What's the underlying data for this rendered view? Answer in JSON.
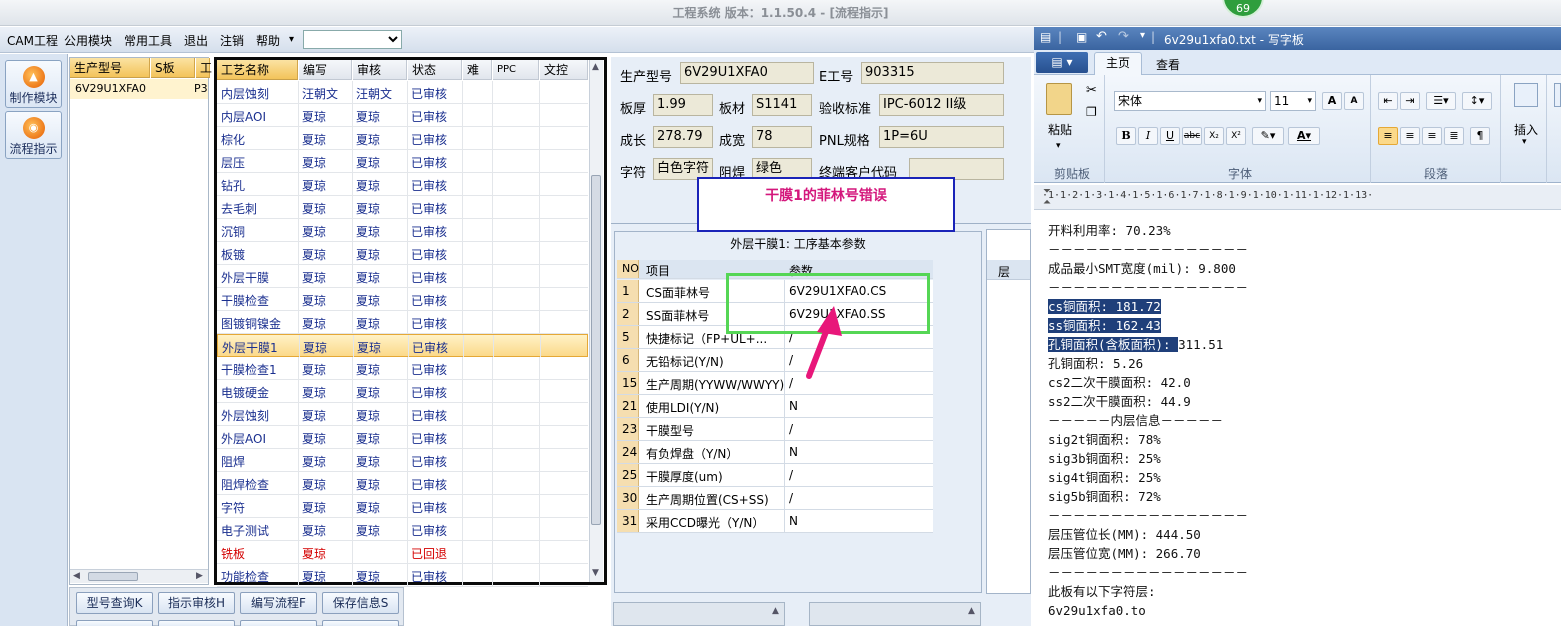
{
  "app": {
    "title": "工程系统   版本：1.1.50.4 - [流程指示]",
    "badge": "69"
  },
  "menu": {
    "items": [
      "CAM工程",
      "公用模块",
      "常用工具",
      "退出",
      "注销",
      "帮助"
    ],
    "dropdown_arrow": "▾"
  },
  "sidebar": {
    "items": [
      {
        "label": "制作模块",
        "icon": "flame-icon"
      },
      {
        "label": "流程指示",
        "icon": "flow-icon"
      }
    ]
  },
  "model_list": {
    "headers": [
      "生产型号",
      "S板",
      "工"
    ],
    "rows": [
      {
        "model": "6V29U1XFA0",
        "tail": "P3"
      }
    ]
  },
  "process_grid": {
    "headers": [
      "工艺名称",
      "编写",
      "审核",
      "状态",
      "难",
      "PPC",
      "文控"
    ],
    "rows": [
      {
        "name": "内层蚀刻",
        "author": "汪朝文",
        "reviewer": "汪朝文",
        "status": "已审核"
      },
      {
        "name": "内层AOI",
        "author": "夏琼",
        "reviewer": "夏琼",
        "status": "已审核"
      },
      {
        "name": "棕化",
        "author": "夏琼",
        "reviewer": "夏琼",
        "status": "已审核"
      },
      {
        "name": "层压",
        "author": "夏琼",
        "reviewer": "夏琼",
        "status": "已审核"
      },
      {
        "name": "钻孔",
        "author": "夏琼",
        "reviewer": "夏琼",
        "status": "已审核"
      },
      {
        "name": "去毛刺",
        "author": "夏琼",
        "reviewer": "夏琼",
        "status": "已审核"
      },
      {
        "name": "沉铜",
        "author": "夏琼",
        "reviewer": "夏琼",
        "status": "已审核"
      },
      {
        "name": "板镀",
        "author": "夏琼",
        "reviewer": "夏琼",
        "status": "已审核"
      },
      {
        "name": "外层干膜",
        "author": "夏琼",
        "reviewer": "夏琼",
        "status": "已审核"
      },
      {
        "name": "干膜检查",
        "author": "夏琼",
        "reviewer": "夏琼",
        "status": "已审核"
      },
      {
        "name": "图镀铜镍金",
        "author": "夏琼",
        "reviewer": "夏琼",
        "status": "已审核"
      },
      {
        "name": "外层干膜1",
        "author": "夏琼",
        "reviewer": "夏琼",
        "status": "已审核"
      },
      {
        "name": "干膜检查1",
        "author": "夏琼",
        "reviewer": "夏琼",
        "status": "已审核"
      },
      {
        "name": "电镀硬金",
        "author": "夏琼",
        "reviewer": "夏琼",
        "status": "已审核"
      },
      {
        "name": "外层蚀刻",
        "author": "夏琼",
        "reviewer": "夏琼",
        "status": "已审核"
      },
      {
        "name": "外层AOI",
        "author": "夏琼",
        "reviewer": "夏琼",
        "status": "已审核"
      },
      {
        "name": "阻焊",
        "author": "夏琼",
        "reviewer": "夏琼",
        "status": "已审核"
      },
      {
        "name": "阻焊检查",
        "author": "夏琼",
        "reviewer": "夏琼",
        "status": "已审核"
      },
      {
        "name": "字符",
        "author": "夏琼",
        "reviewer": "夏琼",
        "status": "已审核"
      },
      {
        "name": "电子测试",
        "author": "夏琼",
        "reviewer": "夏琼",
        "status": "已审核"
      },
      {
        "name": "铣板",
        "author": "夏琼",
        "reviewer": "",
        "status": "已回退"
      },
      {
        "name": "功能检查",
        "author": "夏琼",
        "reviewer": "夏琼",
        "status": "已审核"
      }
    ],
    "selected_index": 11,
    "returned_index": 20
  },
  "buttons": {
    "model_query": "型号查询K",
    "indicate_review": "指示审核H",
    "edit_flow": "编写流程F",
    "save_info": "保存信息S"
  },
  "info": {
    "prod_model_label": "生产型号",
    "prod_model": "6V29U1XFA0",
    "e_no_label": "E工号",
    "e_no": "903315",
    "thickness_label": "板厚",
    "thickness": "1.99",
    "material_label": "板材",
    "material": "S1141",
    "accept_label": "验收标准",
    "accept": "IPC-6012 II级",
    "length_label": "成长",
    "length": "278.79",
    "width_label": "成宽",
    "width": "78",
    "pnl_label": "PNL规格",
    "pnl": "1P=6U",
    "char_label": "字符",
    "char": "白色字符",
    "solder_label": "阻焊",
    "solder": "绿色",
    "customer_label": "终端客户代码",
    "customer": ""
  },
  "callout": {
    "text": "干膜1的菲林号错误"
  },
  "params": {
    "title": "外层干膜1: 工序基本参数",
    "headers": [
      "NO",
      "项目",
      "参数"
    ],
    "rows": [
      {
        "no": "1",
        "item": "CS面菲林号",
        "value": "6V29U1XFA0.CS"
      },
      {
        "no": "2",
        "item": "SS面菲林号",
        "value": "6V29U1XFA0.SS"
      },
      {
        "no": "5",
        "item": "快捷标记（FP+UL+...",
        "value": "/"
      },
      {
        "no": "6",
        "item": "无铅标记(Y/N)",
        "value": "/"
      },
      {
        "no": "15",
        "item": "生产周期(YYWW/WWYY)",
        "value": "/"
      },
      {
        "no": "21",
        "item": "使用LDI(Y/N)",
        "value": "N"
      },
      {
        "no": "23",
        "item": "干膜型号",
        "value": "/"
      },
      {
        "no": "24",
        "item": "有负焊盘（Y/N）",
        "value": "N"
      },
      {
        "no": "25",
        "item": "干膜厚度(um)",
        "value": "/"
      },
      {
        "no": "30",
        "item": "生产周期位置(CS+SS)",
        "value": "/"
      },
      {
        "no": "31",
        "item": "采用CCD曝光（Y/N）",
        "value": "N"
      }
    ],
    "side_header": "层"
  },
  "wordpad": {
    "title": "6v29u1xfa0.txt - 写字板",
    "tabs": [
      "主页",
      "查看"
    ],
    "font_name": "宋体",
    "font_size": "11",
    "groups": [
      "剪贴板",
      "字体",
      "段落"
    ],
    "paste_label": "粘贴",
    "insert_label": "插入",
    "ruler": "·1·1·2·1·3·1·4·1·5·1·6·1·7·1·8·1·9·1·10·1·11·1·12·1·13·",
    "lines": [
      "开料利用率: 70.23%",
      "－－－－－－－－－－－－－－－－",
      "成品最小SMT宽度(mil): 9.800",
      "－－－－－－－－－－－－－－－－",
      "cs铜面积: 181.72",
      "ss铜面积: 162.43",
      "孔铜面积(含板面积): 311.51",
      "孔铜面积: 5.26",
      "cs2二次干膜面积: 42.0",
      "ss2二次干膜面积: 44.9",
      "－－－－－内层信息－－－－－",
      "sig2t铜面积: 78%",
      "sig3b铜面积: 25%",
      "sig4t铜面积: 25%",
      "sig5b铜面积: 72%",
      "－－－－－－－－－－－－－－－－",
      "层压管位长(MM): 444.50",
      "层压管位宽(MM): 266.70",
      "－－－－－－－－－－－－－－－－",
      "此板有以下字符层:",
      "6v29u1xfa0.to"
    ],
    "highlight_lines": [
      4,
      5,
      6
    ]
  },
  "colors": {
    "accent": "#f3c35a",
    "link": "#1a2f8f",
    "returned": "#d40000",
    "callout_text": "#d4177c",
    "arrow": "#e8177a"
  }
}
